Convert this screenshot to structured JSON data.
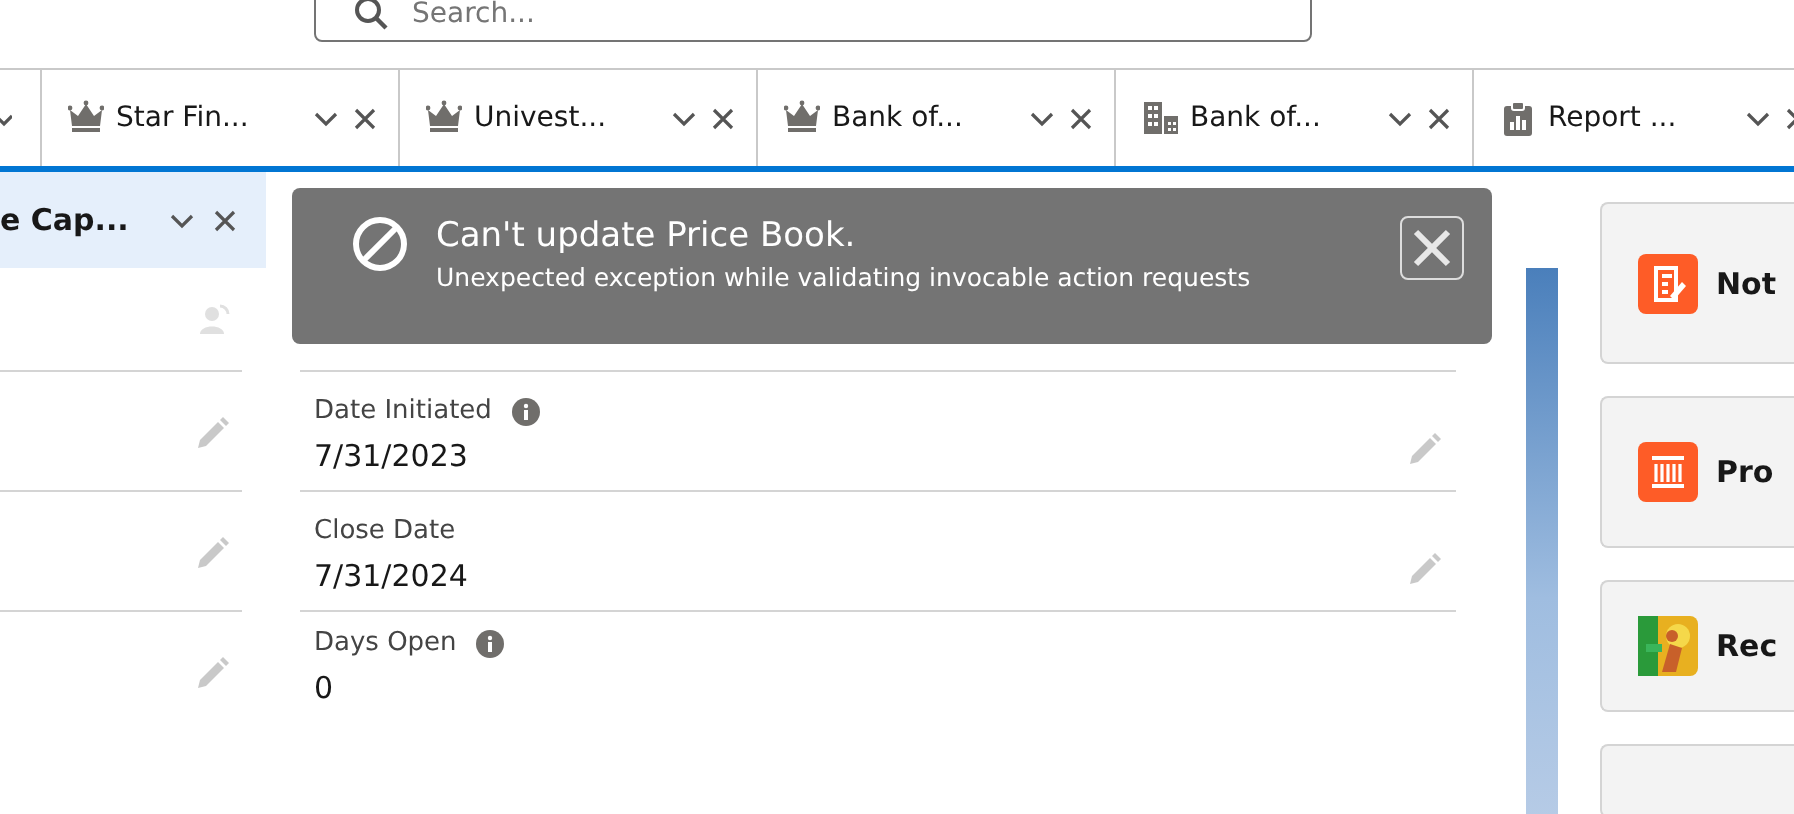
{
  "search": {
    "placeholder": "Search..."
  },
  "tabs": [
    {
      "label": "Star Fin...",
      "kind": "account",
      "selected": false
    },
    {
      "label": "Univest...",
      "kind": "account",
      "selected": false
    },
    {
      "label": "Bank of...",
      "kind": "account",
      "selected": false
    },
    {
      "label": "Bank of...",
      "kind": "building",
      "selected": false
    },
    {
      "label": "Report ...",
      "kind": "report",
      "selected": false
    }
  ],
  "subtabs": [
    {
      "label": "e Cap...",
      "selected": true
    }
  ],
  "fields": [
    {
      "label": "Date Initiated",
      "value": "7/31/2023",
      "info": true,
      "editable": true
    },
    {
      "label": "Close Date",
      "value": "7/31/2024",
      "info": false,
      "editable": true
    },
    {
      "label": "Days Open",
      "value": "0",
      "info": true,
      "editable": false
    }
  ],
  "toast": {
    "title": "Can't update Price Book.",
    "message": "Unexpected exception while validating invocable action requests"
  },
  "cards": [
    {
      "title": "Not",
      "kind": "notes"
    },
    {
      "title": "Pro",
      "kind": "products"
    },
    {
      "title": "Rec"
    }
  ]
}
